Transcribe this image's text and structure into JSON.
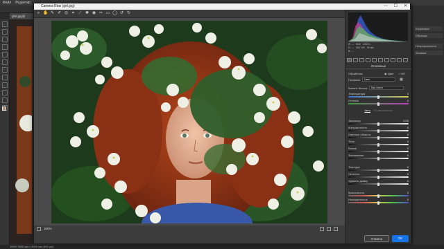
{
  "ps": {
    "menu": [
      "Файл",
      "Редактир"
    ],
    "doc_tab": "ghd.jpg@",
    "right_panel": [
      "Коррекция",
      "Образцы",
      "Непрозрачность",
      "Заливка"
    ],
    "status": "100%   3000 мм x 2000 мм (300 ppi)"
  },
  "acr": {
    "title": "Camera Raw (girl.jpg)",
    "win_min": "—",
    "win_max": "☐",
    "win_close": "✕",
    "exif": {
      "f": "f/3.5",
      "iso": "ISO 100",
      "shutter": "1/200 с",
      "lens": "50 мм",
      "r": "R: ---",
      "g": "G: ---",
      "b": "B: ---"
    },
    "section_title": "Основные",
    "treatment_label": "Обработка:",
    "treatment_color": "Цвет",
    "treatment_bw": "Ч/б",
    "profile_label": "Профиль:",
    "profile_value": "Цвет",
    "wb_label": "Баланс белого:",
    "wb_value": "Как снято",
    "auto_label": "Авто",
    "default_label": "По умолчанию",
    "sliders": [
      {
        "label": "Температура",
        "value": "0",
        "pos": 0.5,
        "grad": "linear-gradient(90deg,#3a6fd6,#d8d050)"
      },
      {
        "label": "Оттенок",
        "value": "0",
        "pos": 0.5,
        "grad": "linear-gradient(90deg,#3ea040,#c040c0)"
      },
      {
        "label": "Экспонир",
        "value": "0,00",
        "pos": 0.5,
        "grad": "linear-gradient(90deg,#111,#eee)"
      },
      {
        "label": "Контрастность",
        "value": "0",
        "pos": 0.5,
        "grad": "linear-gradient(90deg,#111,#eee)"
      },
      {
        "label": "Светлые области",
        "value": "0",
        "pos": 0.5,
        "grad": "linear-gradient(90deg,#111,#eee)"
      },
      {
        "label": "Тени",
        "value": "0",
        "pos": 0.5,
        "grad": "linear-gradient(90deg,#111,#eee)"
      },
      {
        "label": "Белые",
        "value": "0",
        "pos": 0.5,
        "grad": "linear-gradient(90deg,#111,#eee)"
      },
      {
        "label": "Затемнение",
        "value": "0",
        "pos": 0.5,
        "grad": "linear-gradient(90deg,#111,#eee)"
      },
      {
        "label": "Текстура",
        "value": "0",
        "pos": 0.5,
        "grad": "linear-gradient(90deg,#111,#eee)"
      },
      {
        "label": "Четкость",
        "value": "0",
        "pos": 0.5,
        "grad": "linear-gradient(90deg,#111,#eee)"
      },
      {
        "label": "Удалить дымку",
        "value": "0",
        "pos": 0.5,
        "grad": "linear-gradient(90deg,#111,#eee)"
      },
      {
        "label": "Красочность",
        "value": "0",
        "pos": 0.5,
        "grad": "linear-gradient(90deg,#666,#d05050,#d0d050,#50c050,#5050d0)"
      },
      {
        "label": "Насыщенность",
        "value": "0",
        "pos": 0.5,
        "grad": "linear-gradient(90deg,#666,#d05050,#d0d050,#50c050,#5050d0)"
      }
    ],
    "zoom": "100%",
    "cancel_label": "Отмена",
    "ok_label": "OK"
  },
  "colors": {
    "accent": "#1473e6",
    "dialog_bg": "#3c3c3c",
    "panel_bg": "#323232"
  }
}
